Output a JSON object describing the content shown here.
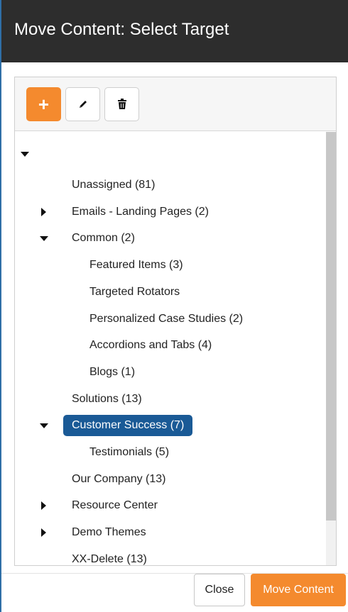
{
  "dialog": {
    "title": "Move Content: Select Target"
  },
  "toolbar": {
    "add_icon": "plus-icon",
    "edit_icon": "pencil-icon",
    "delete_icon": "trash-icon",
    "add_color": "#f48a2e"
  },
  "tree": {
    "root": {
      "expanded": true
    },
    "items": [
      {
        "label": "Unassigned (81)",
        "level": 1,
        "toggle": "none"
      },
      {
        "label": "Emails - Landing Pages (2)",
        "level": 1,
        "toggle": "collapsed"
      },
      {
        "label": "Common (2)",
        "level": 1,
        "toggle": "expanded"
      },
      {
        "label": "Featured Items (3)",
        "level": 2,
        "toggle": "none"
      },
      {
        "label": "Targeted Rotators",
        "level": 2,
        "toggle": "none"
      },
      {
        "label": "Personalized Case Studies (2)",
        "level": 2,
        "toggle": "none"
      },
      {
        "label": "Accordions and Tabs (4)",
        "level": 2,
        "toggle": "none"
      },
      {
        "label": "Blogs (1)",
        "level": 2,
        "toggle": "none"
      },
      {
        "label": "Solutions (13)",
        "level": 1,
        "toggle": "none"
      },
      {
        "label": "Customer Success (7)",
        "level": 1,
        "toggle": "expanded",
        "selected": true
      },
      {
        "label": "Testimonials (5)",
        "level": 2,
        "toggle": "none"
      },
      {
        "label": "Our Company (13)",
        "level": 1,
        "toggle": "none"
      },
      {
        "label": "Resource Center",
        "level": 1,
        "toggle": "collapsed"
      },
      {
        "label": "Demo Themes",
        "level": 1,
        "toggle": "collapsed"
      },
      {
        "label": "XX-Delete (13)",
        "level": 1,
        "toggle": "none"
      }
    ],
    "selected_color": "#1a5a96"
  },
  "footer": {
    "close_label": "Close",
    "move_label": "Move Content",
    "move_color": "#f48a2e"
  }
}
